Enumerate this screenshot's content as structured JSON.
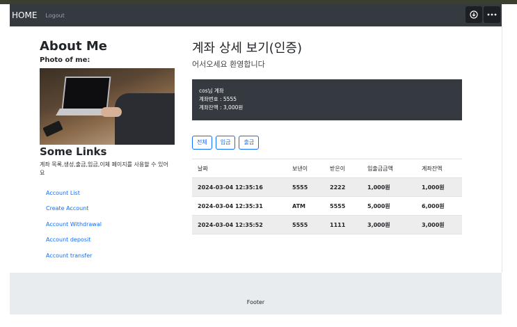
{
  "nav": {
    "home": "HOME",
    "logout": "Logout",
    "icons": [
      "download-icon",
      "more-icon"
    ]
  },
  "sidebar": {
    "about_title": "About Me",
    "photo_caption": "Photo of me:",
    "links_title": "Some Links",
    "links_desc": "계좌 목록,생성,출금,입금,이체 페이지를 사용할 수 있어요",
    "links": [
      "Account List",
      "Create Account",
      "Account Withdrawal",
      "Account deposit",
      "Account transfer"
    ]
  },
  "main": {
    "title": "계좌 상세 보기(인증)",
    "subtitle": "어서오세요 환영합니다",
    "card": {
      "owner": "cos님 계좌",
      "number": "계좌번호 : 5555",
      "balance": "계좌잔액 : 3,000원"
    },
    "filters": [
      "전체",
      "입금",
      "출금"
    ],
    "table": {
      "headers": [
        "날짜",
        "보낸이",
        "받은이",
        "입출금금액",
        "계좌잔액"
      ],
      "rows": [
        [
          "2024-03-04 12:35:16",
          "5555",
          "2222",
          "1,000원",
          "1,000원"
        ],
        [
          "2024-03-04 12:35:31",
          "ATM",
          "5555",
          "5,000원",
          "6,000원"
        ],
        [
          "2024-03-04 12:35:52",
          "5555",
          "1111",
          "3,000원",
          "3,000원"
        ]
      ]
    }
  },
  "footer": {
    "text": "Footer"
  },
  "colors": {
    "navbar": "#343a40",
    "primary": "#0d6efd",
    "card": "#343a40",
    "footer": "#e9ecef"
  }
}
